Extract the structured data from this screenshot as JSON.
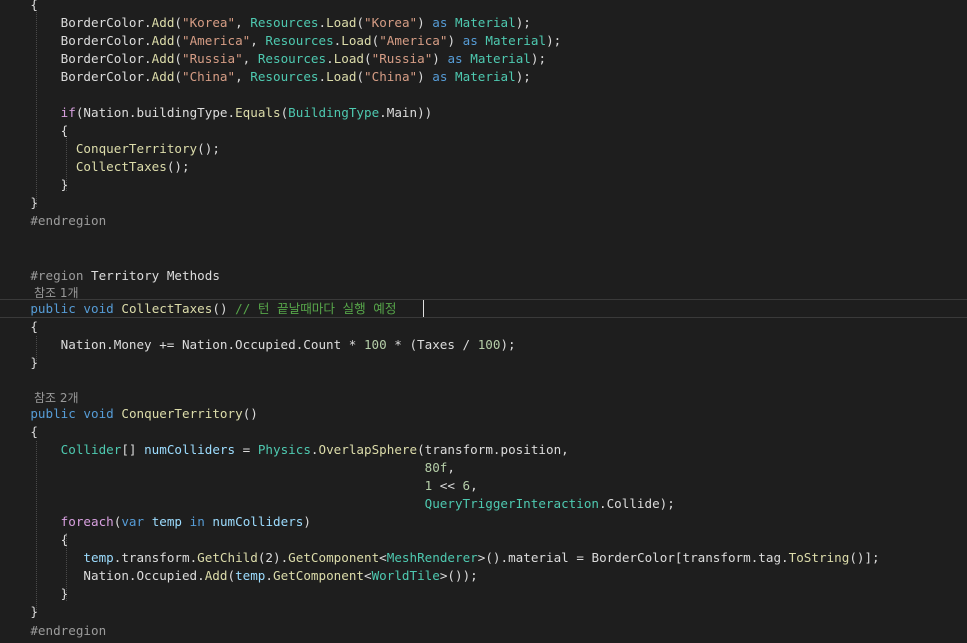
{
  "theme": {
    "background": "#1e1e1e",
    "plain": "#dcdcdc",
    "keyword": "#569cd6",
    "control": "#d8a0df",
    "type": "#4ec9b0",
    "method": "#dcdcaa",
    "string": "#d69d85",
    "number": "#b5cea8",
    "comment": "#57a64a",
    "preprocessor": "#9b9b9b",
    "local": "#9cdcfe",
    "codelens": "#999999"
  },
  "code": {
    "lines": [
      {
        "kind": "code",
        "tokens": [
          [
            "plain",
            "    {"
          ]
        ]
      },
      {
        "kind": "code",
        "tokens": [
          [
            "plain",
            "        BorderColor."
          ],
          [
            "method",
            "Add"
          ],
          [
            "plain",
            "("
          ],
          [
            "str",
            "\"Korea\""
          ],
          [
            "plain",
            ", "
          ],
          [
            "type",
            "Resources"
          ],
          [
            "plain",
            "."
          ],
          [
            "method",
            "Load"
          ],
          [
            "plain",
            "("
          ],
          [
            "str",
            "\"Korea\""
          ],
          [
            "plain",
            ") "
          ],
          [
            "kw",
            "as"
          ],
          [
            "plain",
            " "
          ],
          [
            "type",
            "Material"
          ],
          [
            "plain",
            ");"
          ]
        ]
      },
      {
        "kind": "code",
        "tokens": [
          [
            "plain",
            "        BorderColor."
          ],
          [
            "method",
            "Add"
          ],
          [
            "plain",
            "("
          ],
          [
            "str",
            "\"America\""
          ],
          [
            "plain",
            ", "
          ],
          [
            "type",
            "Resources"
          ],
          [
            "plain",
            "."
          ],
          [
            "method",
            "Load"
          ],
          [
            "plain",
            "("
          ],
          [
            "str",
            "\"America\""
          ],
          [
            "plain",
            ") "
          ],
          [
            "kw",
            "as"
          ],
          [
            "plain",
            " "
          ],
          [
            "type",
            "Material"
          ],
          [
            "plain",
            ");"
          ]
        ]
      },
      {
        "kind": "code",
        "tokens": [
          [
            "plain",
            "        BorderColor."
          ],
          [
            "method",
            "Add"
          ],
          [
            "plain",
            "("
          ],
          [
            "str",
            "\"Russia\""
          ],
          [
            "plain",
            ", "
          ],
          [
            "type",
            "Resources"
          ],
          [
            "plain",
            "."
          ],
          [
            "method",
            "Load"
          ],
          [
            "plain",
            "("
          ],
          [
            "str",
            "\"Russia\""
          ],
          [
            "plain",
            ") "
          ],
          [
            "kw",
            "as"
          ],
          [
            "plain",
            " "
          ],
          [
            "type",
            "Material"
          ],
          [
            "plain",
            ");"
          ]
        ]
      },
      {
        "kind": "code",
        "tokens": [
          [
            "plain",
            "        BorderColor."
          ],
          [
            "method",
            "Add"
          ],
          [
            "plain",
            "("
          ],
          [
            "str",
            "\"China\""
          ],
          [
            "plain",
            ", "
          ],
          [
            "type",
            "Resources"
          ],
          [
            "plain",
            "."
          ],
          [
            "method",
            "Load"
          ],
          [
            "plain",
            "("
          ],
          [
            "str",
            "\"China\""
          ],
          [
            "plain",
            ") "
          ],
          [
            "kw",
            "as"
          ],
          [
            "plain",
            " "
          ],
          [
            "type",
            "Material"
          ],
          [
            "plain",
            ");"
          ]
        ]
      },
      {
        "kind": "code",
        "tokens": []
      },
      {
        "kind": "code",
        "tokens": [
          [
            "plain",
            "        "
          ],
          [
            "ctl",
            "if"
          ],
          [
            "plain",
            "(Nation.buildingType."
          ],
          [
            "method",
            "Equals"
          ],
          [
            "plain",
            "("
          ],
          [
            "type",
            "BuildingType"
          ],
          [
            "plain",
            ".Main))"
          ]
        ]
      },
      {
        "kind": "code",
        "tokens": [
          [
            "plain",
            "        {"
          ]
        ]
      },
      {
        "kind": "code",
        "tokens": [
          [
            "plain",
            "          "
          ],
          [
            "method",
            "ConquerTerritory"
          ],
          [
            "plain",
            "();"
          ]
        ]
      },
      {
        "kind": "code",
        "tokens": [
          [
            "plain",
            "          "
          ],
          [
            "method",
            "CollectTaxes"
          ],
          [
            "plain",
            "();"
          ]
        ]
      },
      {
        "kind": "code",
        "tokens": [
          [
            "plain",
            "        }"
          ]
        ]
      },
      {
        "kind": "code",
        "tokens": [
          [
            "plain",
            "    }"
          ]
        ]
      },
      {
        "kind": "code",
        "tokens": [
          [
            "pre",
            "    #endregion"
          ]
        ]
      },
      {
        "kind": "code",
        "tokens": []
      },
      {
        "kind": "code",
        "tokens": []
      },
      {
        "kind": "code",
        "tokens": [
          [
            "pre",
            "    #region "
          ],
          [
            "plain",
            "Territory Methods"
          ]
        ]
      },
      {
        "kind": "lens",
        "text": "참조 1개"
      },
      {
        "kind": "code",
        "tokens": [
          [
            "kw",
            "    public"
          ],
          [
            "plain",
            " "
          ],
          [
            "kw",
            "void"
          ],
          [
            "plain",
            " "
          ],
          [
            "method",
            "CollectTaxes"
          ],
          [
            "plain",
            "() "
          ],
          [
            "comment",
            "// 턴 끝날때마다 실행 예정"
          ]
        ]
      },
      {
        "kind": "code",
        "tokens": [
          [
            "plain",
            "    {"
          ]
        ]
      },
      {
        "kind": "code",
        "tokens": [
          [
            "plain",
            "        Nation.Money += Nation.Occupied.Count * "
          ],
          [
            "num",
            "100"
          ],
          [
            "plain",
            " * (Taxes / "
          ],
          [
            "num",
            "100"
          ],
          [
            "plain",
            ");"
          ]
        ]
      },
      {
        "kind": "code",
        "tokens": [
          [
            "plain",
            "    }"
          ]
        ]
      },
      {
        "kind": "code",
        "tokens": []
      },
      {
        "kind": "lens",
        "text": "참조 2개"
      },
      {
        "kind": "code",
        "tokens": [
          [
            "kw",
            "    public"
          ],
          [
            "plain",
            " "
          ],
          [
            "kw",
            "void"
          ],
          [
            "plain",
            " "
          ],
          [
            "method",
            "ConquerTerritory"
          ],
          [
            "plain",
            "()"
          ]
        ]
      },
      {
        "kind": "code",
        "tokens": [
          [
            "plain",
            "    {"
          ]
        ]
      },
      {
        "kind": "code",
        "tokens": [
          [
            "plain",
            "        "
          ],
          [
            "type",
            "Collider"
          ],
          [
            "plain",
            "[] "
          ],
          [
            "param",
            "numColliders"
          ],
          [
            "plain",
            " = "
          ],
          [
            "type",
            "Physics"
          ],
          [
            "plain",
            "."
          ],
          [
            "method",
            "OverlapSphere"
          ],
          [
            "plain",
            "(transform.position,"
          ]
        ]
      },
      {
        "kind": "code",
        "tokens": [
          [
            "plain",
            "                                                        "
          ],
          [
            "num",
            "80f"
          ],
          [
            "plain",
            ","
          ]
        ]
      },
      {
        "kind": "code",
        "tokens": [
          [
            "plain",
            "                                                        "
          ],
          [
            "num",
            "1"
          ],
          [
            "plain",
            " << "
          ],
          [
            "num",
            "6"
          ],
          [
            "plain",
            ","
          ]
        ]
      },
      {
        "kind": "code",
        "tokens": [
          [
            "plain",
            "                                                        "
          ],
          [
            "type",
            "QueryTriggerInteraction"
          ],
          [
            "plain",
            ".Collide);"
          ]
        ]
      },
      {
        "kind": "code",
        "tokens": [
          [
            "plain",
            "        "
          ],
          [
            "ctl",
            "foreach"
          ],
          [
            "plain",
            "("
          ],
          [
            "kw",
            "var"
          ],
          [
            "plain",
            " "
          ],
          [
            "param",
            "temp"
          ],
          [
            "plain",
            " "
          ],
          [
            "kw",
            "in"
          ],
          [
            "plain",
            " "
          ],
          [
            "param",
            "numColliders"
          ],
          [
            "plain",
            ")"
          ]
        ]
      },
      {
        "kind": "code",
        "tokens": [
          [
            "plain",
            "        {"
          ]
        ]
      },
      {
        "kind": "code",
        "tokens": [
          [
            "plain",
            "           "
          ],
          [
            "param",
            "temp"
          ],
          [
            "plain",
            ".transform."
          ],
          [
            "method",
            "GetChild"
          ],
          [
            "plain",
            "(2)."
          ],
          [
            "method",
            "GetComponent"
          ],
          [
            "plain",
            "<"
          ],
          [
            "type",
            "MeshRenderer"
          ],
          [
            "plain",
            ">().material = BorderColor[transform.tag."
          ],
          [
            "method",
            "ToString"
          ],
          [
            "plain",
            "()];"
          ]
        ]
      },
      {
        "kind": "code",
        "tokens": [
          [
            "plain",
            "           Nation.Occupied."
          ],
          [
            "method",
            "Add"
          ],
          [
            "plain",
            "("
          ],
          [
            "param",
            "temp"
          ],
          [
            "plain",
            "."
          ],
          [
            "method",
            "GetComponent"
          ],
          [
            "plain",
            "<"
          ],
          [
            "type",
            "WorldTile"
          ],
          [
            "plain",
            ">());"
          ]
        ]
      },
      {
        "kind": "code",
        "tokens": [
          [
            "plain",
            "        }"
          ]
        ]
      },
      {
        "kind": "code",
        "tokens": [
          [
            "plain",
            "    }"
          ]
        ]
      },
      {
        "kind": "code",
        "tokens": [
          [
            "pre",
            "    #endregion"
          ]
        ]
      }
    ]
  }
}
